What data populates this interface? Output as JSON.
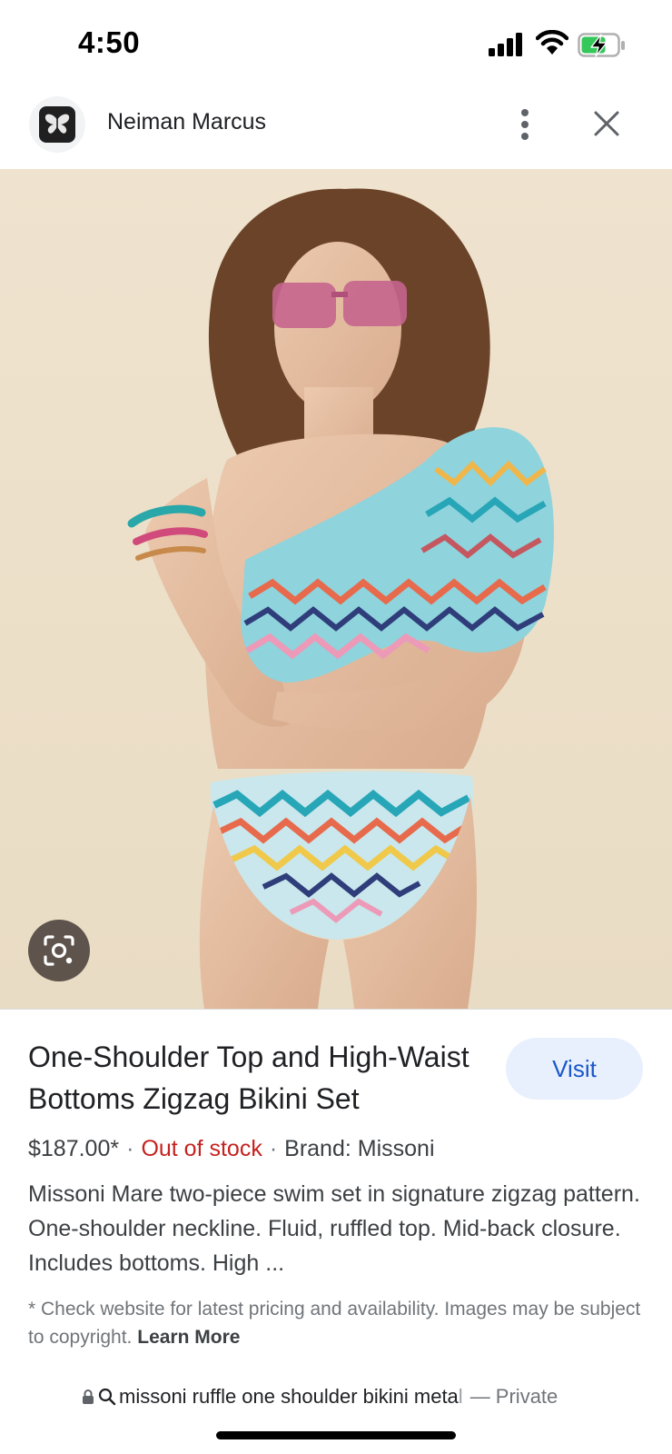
{
  "status_bar": {
    "time": "4:50",
    "battery_color": "#34c759"
  },
  "source": {
    "name": "Neiman Marcus",
    "favicon": "butterfly-icon"
  },
  "product": {
    "title": "One-Shoulder Top and High-Waist Bottoms Zigzag Bikini Set",
    "visit_label": "Visit",
    "price": "$187.00*",
    "stock": "Out of stock",
    "brand": "Brand: Missoni",
    "description": "Missoni Mare two-piece swim set in signature zigzag pattern. One-shoulder neckline. Fluid, ruffled top. Mid-back closure. Includes bottoms. High ...",
    "disclaimer": "* Check website for latest pricing and availability. Images may be subject to copyright.",
    "learn_more": "Learn More"
  },
  "url_bar": {
    "query_visible": "missoni ruffle one shoulder bikini meta",
    "query_faded": "l",
    "private_label": "— Private"
  },
  "colors": {
    "accent": "#1a57c9",
    "visit_bg": "#e8f0fe",
    "stock_red": "#c5221f"
  }
}
